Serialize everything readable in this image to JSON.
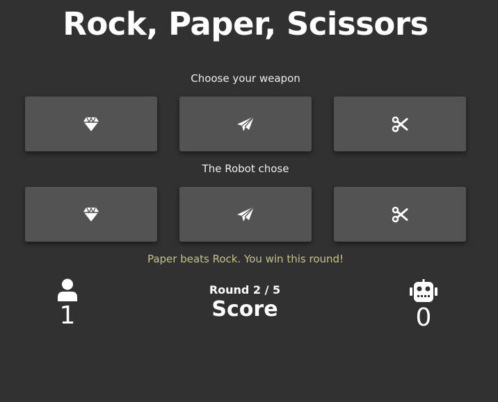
{
  "title": "Rock, Paper, Scissors",
  "player_prompt": "Choose your weapon",
  "robot_prompt": "The Robot chose",
  "weapons": [
    "rock",
    "paper",
    "scissors"
  ],
  "result_message": "Paper beats Rock. You win this round!",
  "round_label": "Round 2 / 5",
  "score_label": "Score",
  "player_score": "1",
  "robot_score": "0",
  "colors": {
    "background": "#313131",
    "button": "#535353",
    "message": "#c6c38a"
  }
}
